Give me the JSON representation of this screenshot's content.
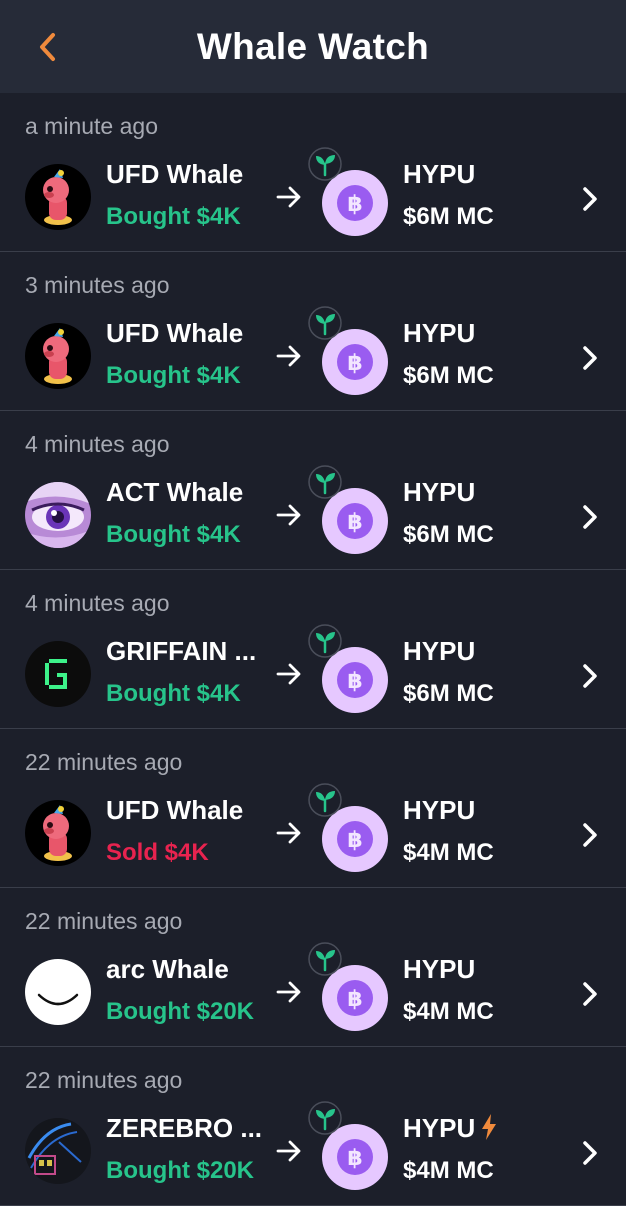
{
  "header": {
    "title": "Whale Watch"
  },
  "colors": {
    "accent": "#f08a3c",
    "buy": "#27c48b",
    "sell": "#e8234f",
    "token_bg": "#e6c8ff",
    "token_fg": "#9a5cf0"
  },
  "rows": [
    {
      "time": "a minute ago",
      "whale": "UFD Whale",
      "action": "Bought $4K",
      "action_type": "buy",
      "avatar": "ufd",
      "token": "HYPU",
      "mc": "$6M MC"
    },
    {
      "time": "3 minutes ago",
      "whale": "UFD Whale",
      "action": "Bought $4K",
      "action_type": "buy",
      "avatar": "ufd",
      "token": "HYPU",
      "mc": "$6M MC"
    },
    {
      "time": "4 minutes ago",
      "whale": "ACT Whale",
      "action": "Bought $4K",
      "action_type": "buy",
      "avatar": "act",
      "token": "HYPU",
      "mc": "$6M MC"
    },
    {
      "time": "4 minutes ago",
      "whale": "GRIFFAIN ...",
      "action": "Bought $4K",
      "action_type": "buy",
      "avatar": "griffain",
      "token": "HYPU",
      "mc": "$6M MC"
    },
    {
      "time": "22 minutes ago",
      "whale": "UFD Whale",
      "action": "Sold $4K",
      "action_type": "sell",
      "avatar": "ufd",
      "token": "HYPU",
      "mc": "$4M MC"
    },
    {
      "time": "22 minutes ago",
      "whale": "arc Whale",
      "action": "Bought $20K",
      "action_type": "buy",
      "avatar": "arc",
      "token": "HYPU",
      "mc": "$4M MC"
    },
    {
      "time": "22 minutes ago",
      "whale": "ZEREBRO ...",
      "action": "Bought $20K",
      "action_type": "buy",
      "avatar": "zerebro",
      "token": "HYPU",
      "mc": "$4M MC",
      "token_badge": "lightning-icon"
    }
  ]
}
